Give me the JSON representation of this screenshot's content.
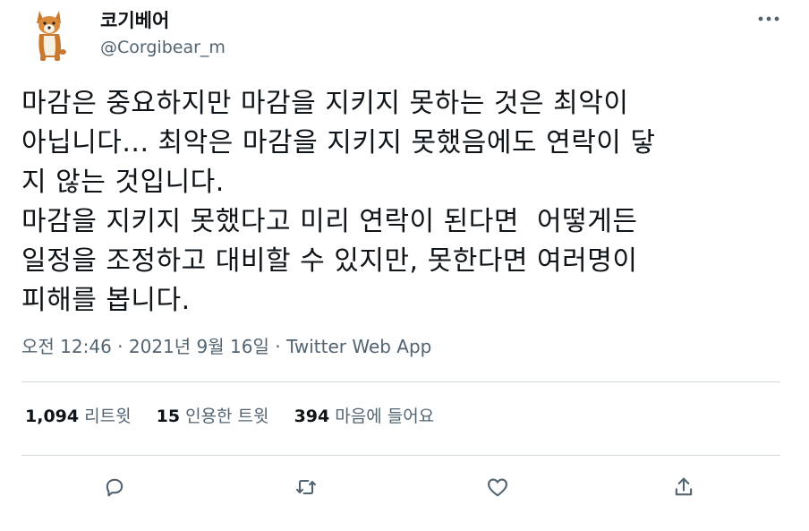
{
  "user": {
    "display_name": "코기베어",
    "handle": "@Corgibear_m",
    "avatar_icon": "corgi-avatar-icon"
  },
  "tweet": {
    "text": "마감은 중요하지만 마감을 지키지 못하는 것은 최악이\n아닙니다... 최악은 마감을 지키지 못했음에도 연락이 닿\n지 않는 것입니다.\n마감을 지키지 못했다고 미리 연락이 된다면  어떻게든\n일정을 조정하고 대비할 수 있지만, 못한다면 여러명이\n피해를 봅니다."
  },
  "meta": {
    "time": "오전 12:46",
    "sep1": " · ",
    "date": "2021년 9월 16일",
    "sep2": " · ",
    "source": "Twitter Web App"
  },
  "stats": {
    "retweets_count": "1,094",
    "retweets_label": "리트윗",
    "quotes_count": "15",
    "quotes_label": "인용한 트윗",
    "likes_count": "394",
    "likes_label": "마음에 들어요"
  },
  "icons": {
    "more": "more-dots-icon",
    "reply": "reply-bubble-icon",
    "retweet": "retweet-icon",
    "like": "heart-icon",
    "share": "share-icon"
  },
  "colors": {
    "text": "#0f1419",
    "secondary": "#536471",
    "divider": "#cfd9de"
  }
}
